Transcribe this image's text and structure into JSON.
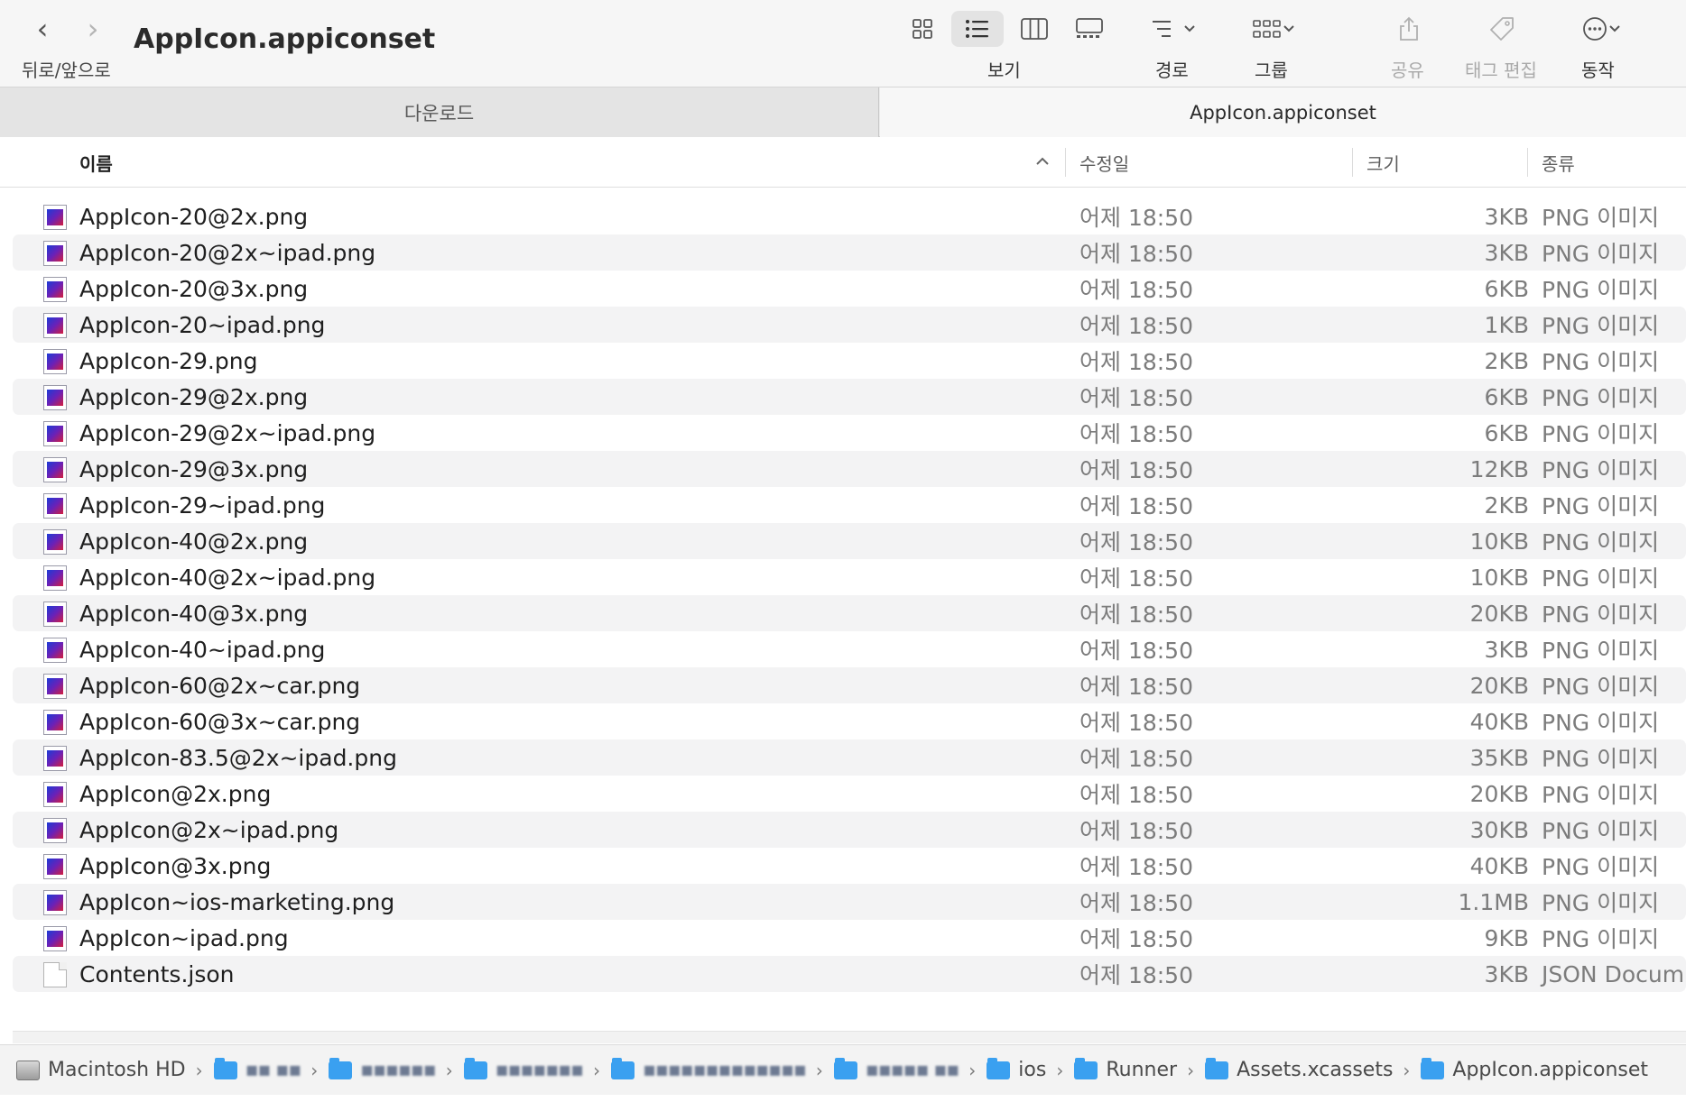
{
  "window": {
    "title": "AppIcon.appiconset",
    "nav_label": "뒤로/앞으로"
  },
  "toolbar": {
    "view_label": "보기",
    "path_label": "경로",
    "group_label": "그룹",
    "share_label": "공유",
    "tags_label": "태그 편집",
    "action_label": "동작"
  },
  "tabs": [
    {
      "label": "다운로드",
      "active": false
    },
    {
      "label": "AppIcon.appiconset",
      "active": true
    }
  ],
  "columns": {
    "name": "이름",
    "modified": "수정일",
    "size": "크기",
    "kind": "종류"
  },
  "files": [
    {
      "name": "AppIcon-20@2x.png",
      "modified": "어제 18:50",
      "size": "3KB",
      "kind": "PNG 이미지",
      "type": "png"
    },
    {
      "name": "AppIcon-20@2x~ipad.png",
      "modified": "어제 18:50",
      "size": "3KB",
      "kind": "PNG 이미지",
      "type": "png"
    },
    {
      "name": "AppIcon-20@3x.png",
      "modified": "어제 18:50",
      "size": "6KB",
      "kind": "PNG 이미지",
      "type": "png"
    },
    {
      "name": "AppIcon-20~ipad.png",
      "modified": "어제 18:50",
      "size": "1KB",
      "kind": "PNG 이미지",
      "type": "png"
    },
    {
      "name": "AppIcon-29.png",
      "modified": "어제 18:50",
      "size": "2KB",
      "kind": "PNG 이미지",
      "type": "png"
    },
    {
      "name": "AppIcon-29@2x.png",
      "modified": "어제 18:50",
      "size": "6KB",
      "kind": "PNG 이미지",
      "type": "png"
    },
    {
      "name": "AppIcon-29@2x~ipad.png",
      "modified": "어제 18:50",
      "size": "6KB",
      "kind": "PNG 이미지",
      "type": "png"
    },
    {
      "name": "AppIcon-29@3x.png",
      "modified": "어제 18:50",
      "size": "12KB",
      "kind": "PNG 이미지",
      "type": "png"
    },
    {
      "name": "AppIcon-29~ipad.png",
      "modified": "어제 18:50",
      "size": "2KB",
      "kind": "PNG 이미지",
      "type": "png"
    },
    {
      "name": "AppIcon-40@2x.png",
      "modified": "어제 18:50",
      "size": "10KB",
      "kind": "PNG 이미지",
      "type": "png"
    },
    {
      "name": "AppIcon-40@2x~ipad.png",
      "modified": "어제 18:50",
      "size": "10KB",
      "kind": "PNG 이미지",
      "type": "png"
    },
    {
      "name": "AppIcon-40@3x.png",
      "modified": "어제 18:50",
      "size": "20KB",
      "kind": "PNG 이미지",
      "type": "png"
    },
    {
      "name": "AppIcon-40~ipad.png",
      "modified": "어제 18:50",
      "size": "3KB",
      "kind": "PNG 이미지",
      "type": "png"
    },
    {
      "name": "AppIcon-60@2x~car.png",
      "modified": "어제 18:50",
      "size": "20KB",
      "kind": "PNG 이미지",
      "type": "png"
    },
    {
      "name": "AppIcon-60@3x~car.png",
      "modified": "어제 18:50",
      "size": "40KB",
      "kind": "PNG 이미지",
      "type": "png"
    },
    {
      "name": "AppIcon-83.5@2x~ipad.png",
      "modified": "어제 18:50",
      "size": "35KB",
      "kind": "PNG 이미지",
      "type": "png"
    },
    {
      "name": "AppIcon@2x.png",
      "modified": "어제 18:50",
      "size": "20KB",
      "kind": "PNG 이미지",
      "type": "png"
    },
    {
      "name": "AppIcon@2x~ipad.png",
      "modified": "어제 18:50",
      "size": "30KB",
      "kind": "PNG 이미지",
      "type": "png"
    },
    {
      "name": "AppIcon@3x.png",
      "modified": "어제 18:50",
      "size": "40KB",
      "kind": "PNG 이미지",
      "type": "png"
    },
    {
      "name": "AppIcon~ios-marketing.png",
      "modified": "어제 18:50",
      "size": "1.1MB",
      "kind": "PNG 이미지",
      "type": "png"
    },
    {
      "name": "AppIcon~ipad.png",
      "modified": "어제 18:50",
      "size": "9KB",
      "kind": "PNG 이미지",
      "type": "png"
    },
    {
      "name": "Contents.json",
      "modified": "어제 18:50",
      "size": "3KB",
      "kind": "JSON Docum",
      "type": "json"
    }
  ],
  "pathbar": [
    {
      "label": "Macintosh HD",
      "icon": "hard-drive-icon",
      "blurred": false
    },
    {
      "label": "▪▪ ▪▪",
      "icon": "folder-icon",
      "blurred": true
    },
    {
      "label": "▪▪▪▪▪▪",
      "icon": "folder-icon",
      "blurred": true
    },
    {
      "label": "▪▪▪▪▪▪▪",
      "icon": "folder-icon",
      "blurred": true
    },
    {
      "label": "▪▪▪▪▪▪▪▪▪▪▪▪▪",
      "icon": "folder-icon",
      "blurred": true
    },
    {
      "label": "▪▪▪▪▪ ▪▪",
      "icon": "folder-icon",
      "blurred": true
    },
    {
      "label": "ios",
      "icon": "folder-icon",
      "blurred": false
    },
    {
      "label": "Runner",
      "icon": "folder-icon",
      "blurred": false
    },
    {
      "label": "Assets.xcassets",
      "icon": "folder-icon",
      "blurred": false
    },
    {
      "label": "AppIcon.appiconset",
      "icon": "folder-icon",
      "blurred": false
    }
  ],
  "colors": {
    "toolbar_bg": "#f6f6f6",
    "row_alt_bg": "#f3f3f4",
    "folder_blue": "#3aa0f0"
  }
}
